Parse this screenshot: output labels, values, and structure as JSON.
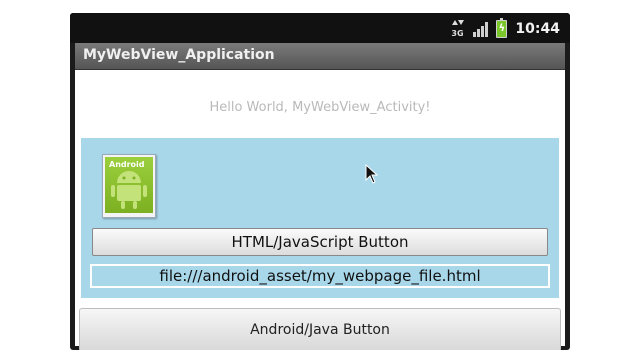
{
  "status_bar": {
    "network": "3G",
    "time": "10:44",
    "icons": [
      "3g-data-icon",
      "signal-strength-icon",
      "battery-charging-icon"
    ]
  },
  "app": {
    "title": "MyWebView_Application"
  },
  "main": {
    "hello_text": "Hello World, MyWebView_Activity!"
  },
  "webview": {
    "image_label": "Android",
    "html_button_label": "HTML/JavaScript Button",
    "url_text": "file:///android_asset/my_webpage_file.html",
    "background_color": "#a9d7ea"
  },
  "native": {
    "android_button_label": "Android/Java Button"
  }
}
